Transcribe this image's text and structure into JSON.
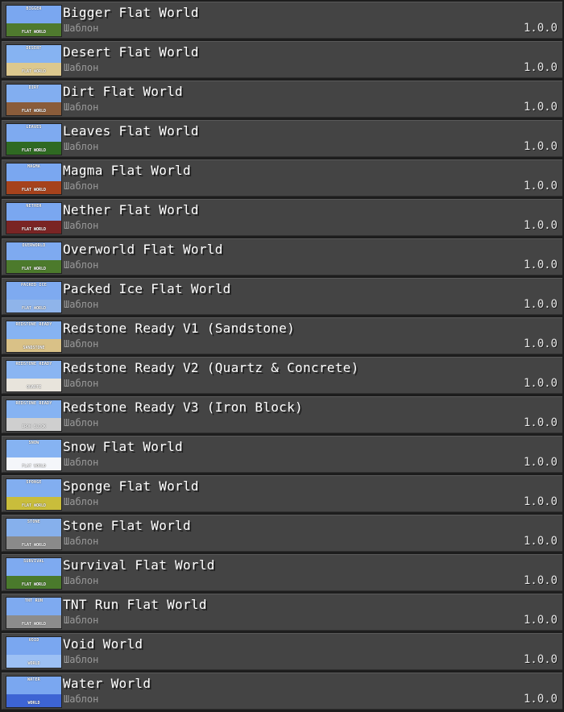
{
  "templates": [
    {
      "title": "Bigger Flat World",
      "subtitle": "Шаблон",
      "version": "1.0.0",
      "thumb_title": "BIGGER",
      "thumb_sub": "FLAT WORLD",
      "sky": "#7aa7f0",
      "ground": "#4f7a2e"
    },
    {
      "title": "Desert Flat World",
      "subtitle": "Шаблон",
      "version": "1.0.0",
      "thumb_title": "DESERT",
      "thumb_sub": "FLAT WORLD",
      "sky": "#86b3f2",
      "ground": "#dcc88e"
    },
    {
      "title": "Dirt Flat World",
      "subtitle": "Шаблон",
      "version": "1.0.0",
      "thumb_title": "DIRT",
      "thumb_sub": "FLAT WORLD",
      "sky": "#82aef0",
      "ground": "#8a5c3a"
    },
    {
      "title": "Leaves Flat World",
      "subtitle": "Шаблон",
      "version": "1.0.0",
      "thumb_title": "LEAVES",
      "thumb_sub": "FLAT WORLD",
      "sky": "#7eaaf0",
      "ground": "#2f6a22"
    },
    {
      "title": "Magma Flat World",
      "subtitle": "Шаблон",
      "version": "1.0.0",
      "thumb_title": "MAGMA",
      "thumb_sub": "FLAT WORLD",
      "sky": "#7aa7f0",
      "ground": "#a6421c"
    },
    {
      "title": "Nether Flat World",
      "subtitle": "Шаблон",
      "version": "1.0.0",
      "thumb_title": "NETHER",
      "thumb_sub": "FLAT WORLD",
      "sky": "#7aa7f0",
      "ground": "#7a2424"
    },
    {
      "title": "Overworld Flat World",
      "subtitle": "Шаблон",
      "version": "1.0.0",
      "thumb_title": "OVERWORLD",
      "thumb_sub": "FLAT WORLD",
      "sky": "#7eaaf0",
      "ground": "#4c7a2c"
    },
    {
      "title": "Packed Ice Flat World",
      "subtitle": "Шаблон",
      "version": "1.0.0",
      "thumb_title": "PACKED ICE",
      "thumb_sub": "FLAT WORLD",
      "sky": "#7eaaf0",
      "ground": "#8fb4ea"
    },
    {
      "title": "Redstone Ready V1 (Sandstone)",
      "subtitle": "Шаблон",
      "version": "1.0.0",
      "thumb_title": "REDSTONE READY",
      "thumb_sub": "SANDSTONE",
      "sky": "#86b3f2",
      "ground": "#d9c187"
    },
    {
      "title": "Redstone Ready V2 (Quartz & Concrete)",
      "subtitle": "Шаблон",
      "version": "1.0.0",
      "thumb_title": "REDSTONE READY",
      "thumb_sub": "QUARTZ",
      "sky": "#8ab5f2",
      "ground": "#e8e4dc"
    },
    {
      "title": "Redstone Ready V3 (Iron Block)",
      "subtitle": "Шаблон",
      "version": "1.0.0",
      "thumb_title": "REDSTONE READY",
      "thumb_sub": "IRON BLOCK",
      "sky": "#86b3f2",
      "ground": "#cfcfcf"
    },
    {
      "title": "Snow Flat World",
      "subtitle": "Шаблон",
      "version": "1.0.0",
      "thumb_title": "SNOW",
      "thumb_sub": "FLAT WORLD",
      "sky": "#86b3f2",
      "ground": "#f4f6fa"
    },
    {
      "title": "Sponge Flat World",
      "subtitle": "Шаблон",
      "version": "1.0.0",
      "thumb_title": "SPONGE",
      "thumb_sub": "FLAT WORLD",
      "sky": "#82aef0",
      "ground": "#c9bd3b"
    },
    {
      "title": "Stone Flat World",
      "subtitle": "Шаблон",
      "version": "1.0.0",
      "thumb_title": "STONE",
      "thumb_sub": "FLAT WORLD",
      "sky": "#86b0ec",
      "ground": "#8a8a8a"
    },
    {
      "title": "Survival Flat World",
      "subtitle": "Шаблон",
      "version": "1.0.0",
      "thumb_title": "SURVIVAL",
      "thumb_sub": "FLAT WORLD",
      "sky": "#7eaaf0",
      "ground": "#4a7a2c"
    },
    {
      "title": "TNT Run Flat World",
      "subtitle": "Шаблон",
      "version": "1.0.0",
      "thumb_title": "TNT RUN",
      "thumb_sub": "FLAT WORLD",
      "sky": "#7eaaf0",
      "ground": "#8c8c8c"
    },
    {
      "title": "Void World",
      "subtitle": "Шаблон",
      "version": "1.0.0",
      "thumb_title": "VOID",
      "thumb_sub": "WORLD",
      "sky": "#7aa7f0",
      "ground": "#9cc0f4"
    },
    {
      "title": "Water World",
      "subtitle": "Шаблон",
      "version": "1.0.0",
      "thumb_title": "WATER",
      "thumb_sub": "WORLD",
      "sky": "#7aa7f0",
      "ground": "#3d64d4"
    }
  ]
}
